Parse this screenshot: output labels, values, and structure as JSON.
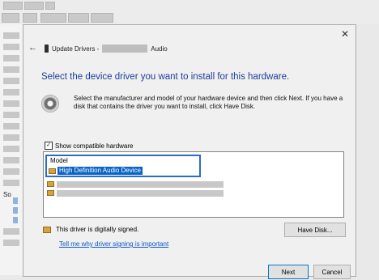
{
  "dialog": {
    "title_prefix": "Update Drivers -",
    "title_suffix": "Audio",
    "heading": "Select the device driver you want to install for this hardware.",
    "description": "Select the manufacturer and model of your hardware device and then click Next. If you have a disk that contains the driver you want to install, click Have Disk.",
    "show_compatible": {
      "label": "Show compatible hardware",
      "checked": true,
      "check_glyph": "✓"
    },
    "model_list": {
      "header": "Model",
      "items": [
        {
          "label": "High Definition Audio Device",
          "selected": true
        }
      ]
    },
    "signed_text": "This driver is digitally signed.",
    "signing_link": "Tell me why driver signing is important",
    "have_disk_label": "Have Disk...",
    "next_label": "Next",
    "cancel_label": "Cancel",
    "close_glyph": "✕",
    "back_glyph": "←"
  },
  "background": {
    "left_label": "So"
  }
}
